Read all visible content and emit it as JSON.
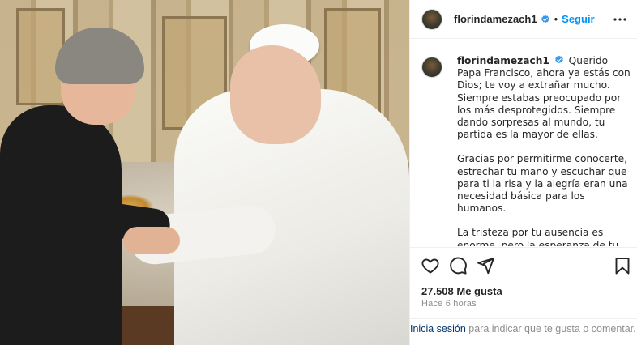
{
  "post": {
    "username": "florindamezach1",
    "verified": true,
    "follow_label": "Seguir",
    "separator": "•",
    "more_icon": "more-horizontal-icon"
  },
  "caption": {
    "username": "florindamezach1",
    "paragraphs": [
      "Querido Papa Francisco, ahora ya estás con Dios; te voy a extrañar mucho. Siempre estabas preocupado por los más desprotegidos. Siempre dando sorpresas al mundo, tu partida es la mayor de ellas.",
      "Gracias por permitirme conocerte, estrechar tu mano y escuchar que para ti la risa y la alegría eran una necesidad básica para los humanos.",
      "La tristeza por tu ausencia es enorme, pero la esperanza de tu legado es mayor."
    ]
  },
  "actions": {
    "like_icon": "heart-icon",
    "comment_icon": "comment-icon",
    "share_icon": "send-icon",
    "save_icon": "bookmark-icon"
  },
  "stats": {
    "likes": "27.508 Me gusta",
    "time": "Hace 6 horas"
  },
  "login": {
    "link_label": "Inicia sesión",
    "rest": " para indicar que te gusta o comentar."
  },
  "colors": {
    "link_blue": "#0095f6",
    "verified_blue": "#3897f0",
    "text": "#262626",
    "secondary": "#8e8e8e"
  }
}
